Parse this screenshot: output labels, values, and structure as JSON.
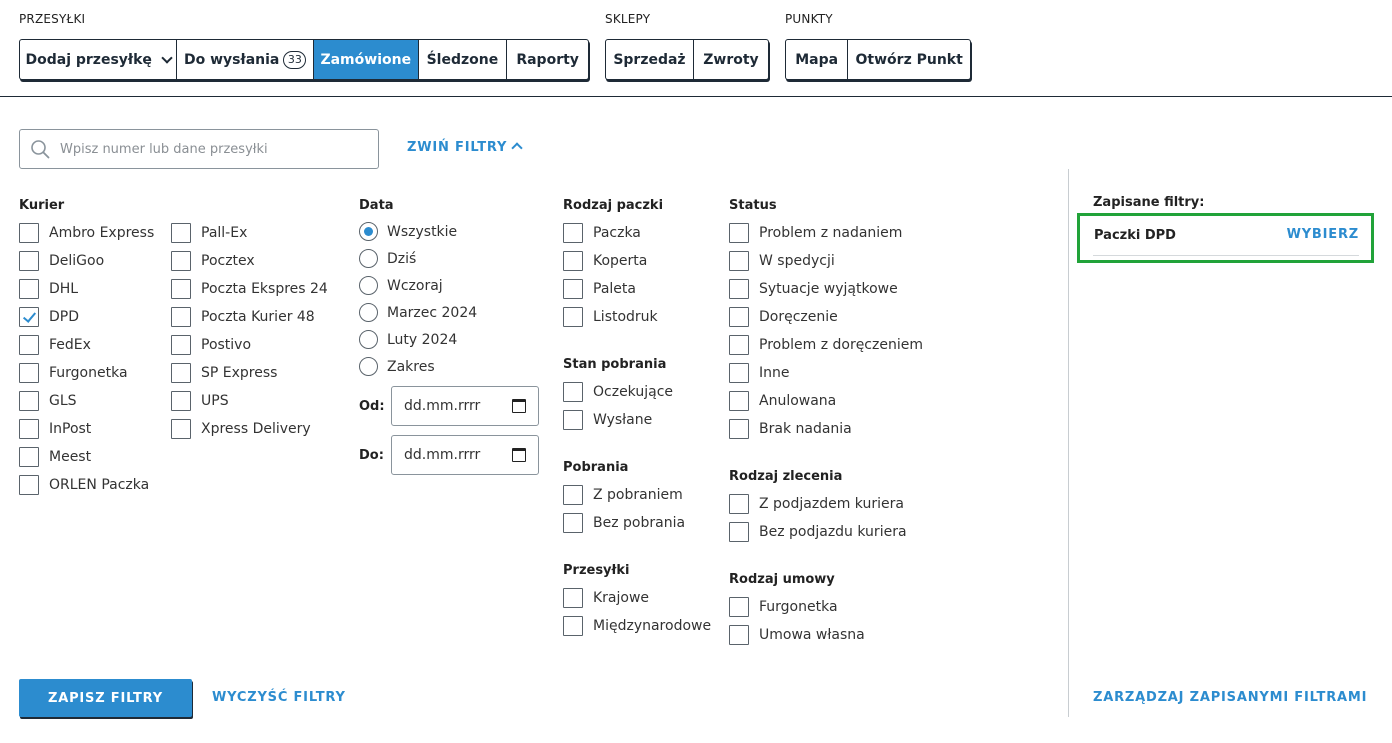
{
  "nav": {
    "przesylki": {
      "label": "PRZESYŁKI",
      "buttons": [
        {
          "label": "Dodaj przesyłkę"
        },
        {
          "label": "Do wysłania",
          "badge": "33"
        },
        {
          "label": "Zamówione",
          "active": true
        },
        {
          "label": "Śledzone"
        },
        {
          "label": "Raporty"
        }
      ]
    },
    "sklepy": {
      "label": "SKLEPY",
      "buttons": [
        {
          "label": "Sprzedaż"
        },
        {
          "label": "Zwroty"
        }
      ]
    },
    "punkty": {
      "label": "PUNKTY",
      "buttons": [
        {
          "label": "Mapa"
        },
        {
          "label": "Otwórz Punkt"
        }
      ]
    }
  },
  "search": {
    "placeholder": "Wpisz numer lub dane przesyłki",
    "value": ""
  },
  "collapse_filters": "ZWIŃ FILTRY",
  "kurier": {
    "title": "Kurier",
    "col1": [
      {
        "label": "Ambro Express"
      },
      {
        "label": "DeliGoo"
      },
      {
        "label": "DHL"
      },
      {
        "label": "DPD",
        "checked": true
      },
      {
        "label": "FedEx"
      },
      {
        "label": "Furgonetka"
      },
      {
        "label": "GLS"
      },
      {
        "label": "InPost"
      },
      {
        "label": "Meest"
      },
      {
        "label": "ORLEN Paczka"
      }
    ],
    "col2": [
      {
        "label": "Pall-Ex"
      },
      {
        "label": "Pocztex"
      },
      {
        "label": "Poczta Ekspres 24"
      },
      {
        "label": "Poczta Kurier 48"
      },
      {
        "label": "Postivo"
      },
      {
        "label": "SP Express"
      },
      {
        "label": "UPS"
      },
      {
        "label": "Xpress Delivery"
      }
    ]
  },
  "data": {
    "title": "Data",
    "options": [
      {
        "label": "Wszystkie",
        "checked": true
      },
      {
        "label": "Dziś"
      },
      {
        "label": "Wczoraj"
      },
      {
        "label": "Marzec 2024"
      },
      {
        "label": "Luty 2024"
      },
      {
        "label": "Zakres"
      }
    ],
    "od_label": "Od:",
    "do_label": "Do:",
    "od_value": "dd.mm.rrrr",
    "do_value": "dd.mm.rrrr"
  },
  "rodzaj_paczki": {
    "title": "Rodzaj paczki",
    "items": [
      {
        "label": "Paczka"
      },
      {
        "label": "Koperta"
      },
      {
        "label": "Paleta"
      },
      {
        "label": "Listodruk"
      }
    ]
  },
  "stan_pobrania": {
    "title": "Stan pobrania",
    "items": [
      {
        "label": "Oczekujące"
      },
      {
        "label": "Wysłane"
      }
    ]
  },
  "pobrania": {
    "title": "Pobrania",
    "items": [
      {
        "label": "Z pobraniem"
      },
      {
        "label": "Bez pobrania"
      }
    ]
  },
  "przesylki": {
    "title": "Przesyłki",
    "items": [
      {
        "label": "Krajowe"
      },
      {
        "label": "Międzynarodowe"
      }
    ]
  },
  "status": {
    "title": "Status",
    "items": [
      {
        "label": "Problem z nadaniem"
      },
      {
        "label": "W spedycji"
      },
      {
        "label": "Sytuacje wyjątkowe"
      },
      {
        "label": "Doręczenie"
      },
      {
        "label": "Problem z doręczeniem"
      },
      {
        "label": "Inne"
      },
      {
        "label": "Anulowana"
      },
      {
        "label": "Brak nadania"
      }
    ]
  },
  "rodzaj_zlecenia": {
    "title": "Rodzaj zlecenia",
    "items": [
      {
        "label": "Z podjazdem kuriera"
      },
      {
        "label": "Bez podjazdu kuriera"
      }
    ]
  },
  "rodzaj_umowy": {
    "title": "Rodzaj umowy",
    "items": [
      {
        "label": "Furgonetka"
      },
      {
        "label": "Umowa własna"
      }
    ]
  },
  "saved": {
    "title": "Zapisane filtry:",
    "filter_name": "Paczki DPD",
    "select_label": "WYBIERZ",
    "manage_label": "ZARZĄDZAJ ZAPISANYMI FILTRAMI"
  },
  "actions": {
    "save_label": "ZAPISZ FILTRY",
    "clear_label": "WYCZYŚĆ FILTRY"
  },
  "colors": {
    "accent": "#2c8ccf",
    "highlight": "#21a339",
    "dark": "#1e2a36"
  }
}
